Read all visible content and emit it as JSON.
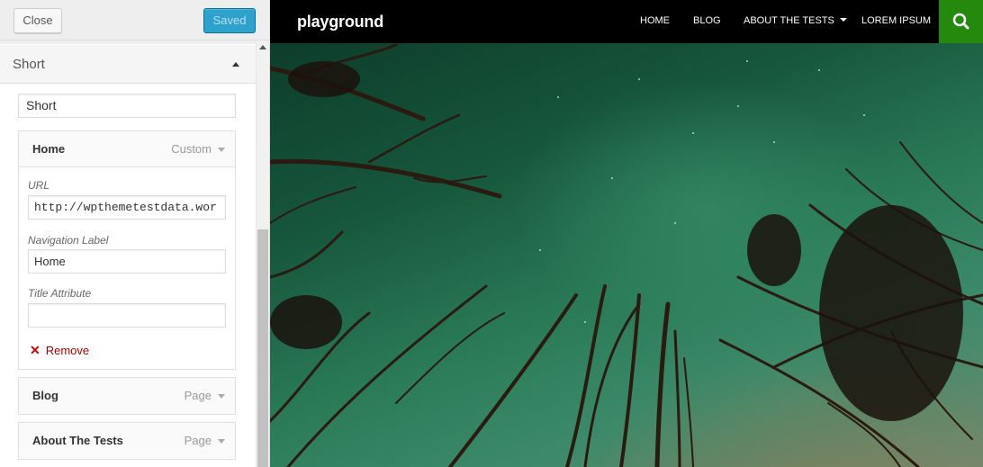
{
  "customizer": {
    "close_label": "Close",
    "saved_label": "Saved",
    "section_title": "Short",
    "menu_name_value": "Short",
    "items": [
      {
        "title": "Home",
        "type": "Custom",
        "url_label": "URL",
        "url_value": "http://wpthemetestdata.wor",
        "nav_label_label": "Navigation Label",
        "nav_label_value": "Home",
        "title_attr_label": "Title Attribute",
        "title_attr_value": "",
        "remove_label": "Remove"
      },
      {
        "title": "Blog",
        "type": "Page"
      },
      {
        "title": "About The Tests",
        "type": "Page"
      }
    ]
  },
  "site": {
    "title": "playground",
    "nav": [
      "HOME",
      "BLOG",
      "ABOUT THE TESTS",
      "LOREM IPSUM"
    ],
    "accent_color": "#24890d"
  },
  "icons": {
    "collapse": "triangle-up-icon",
    "expand": "triangle-down-icon",
    "remove": "x-icon",
    "search": "search-icon"
  }
}
